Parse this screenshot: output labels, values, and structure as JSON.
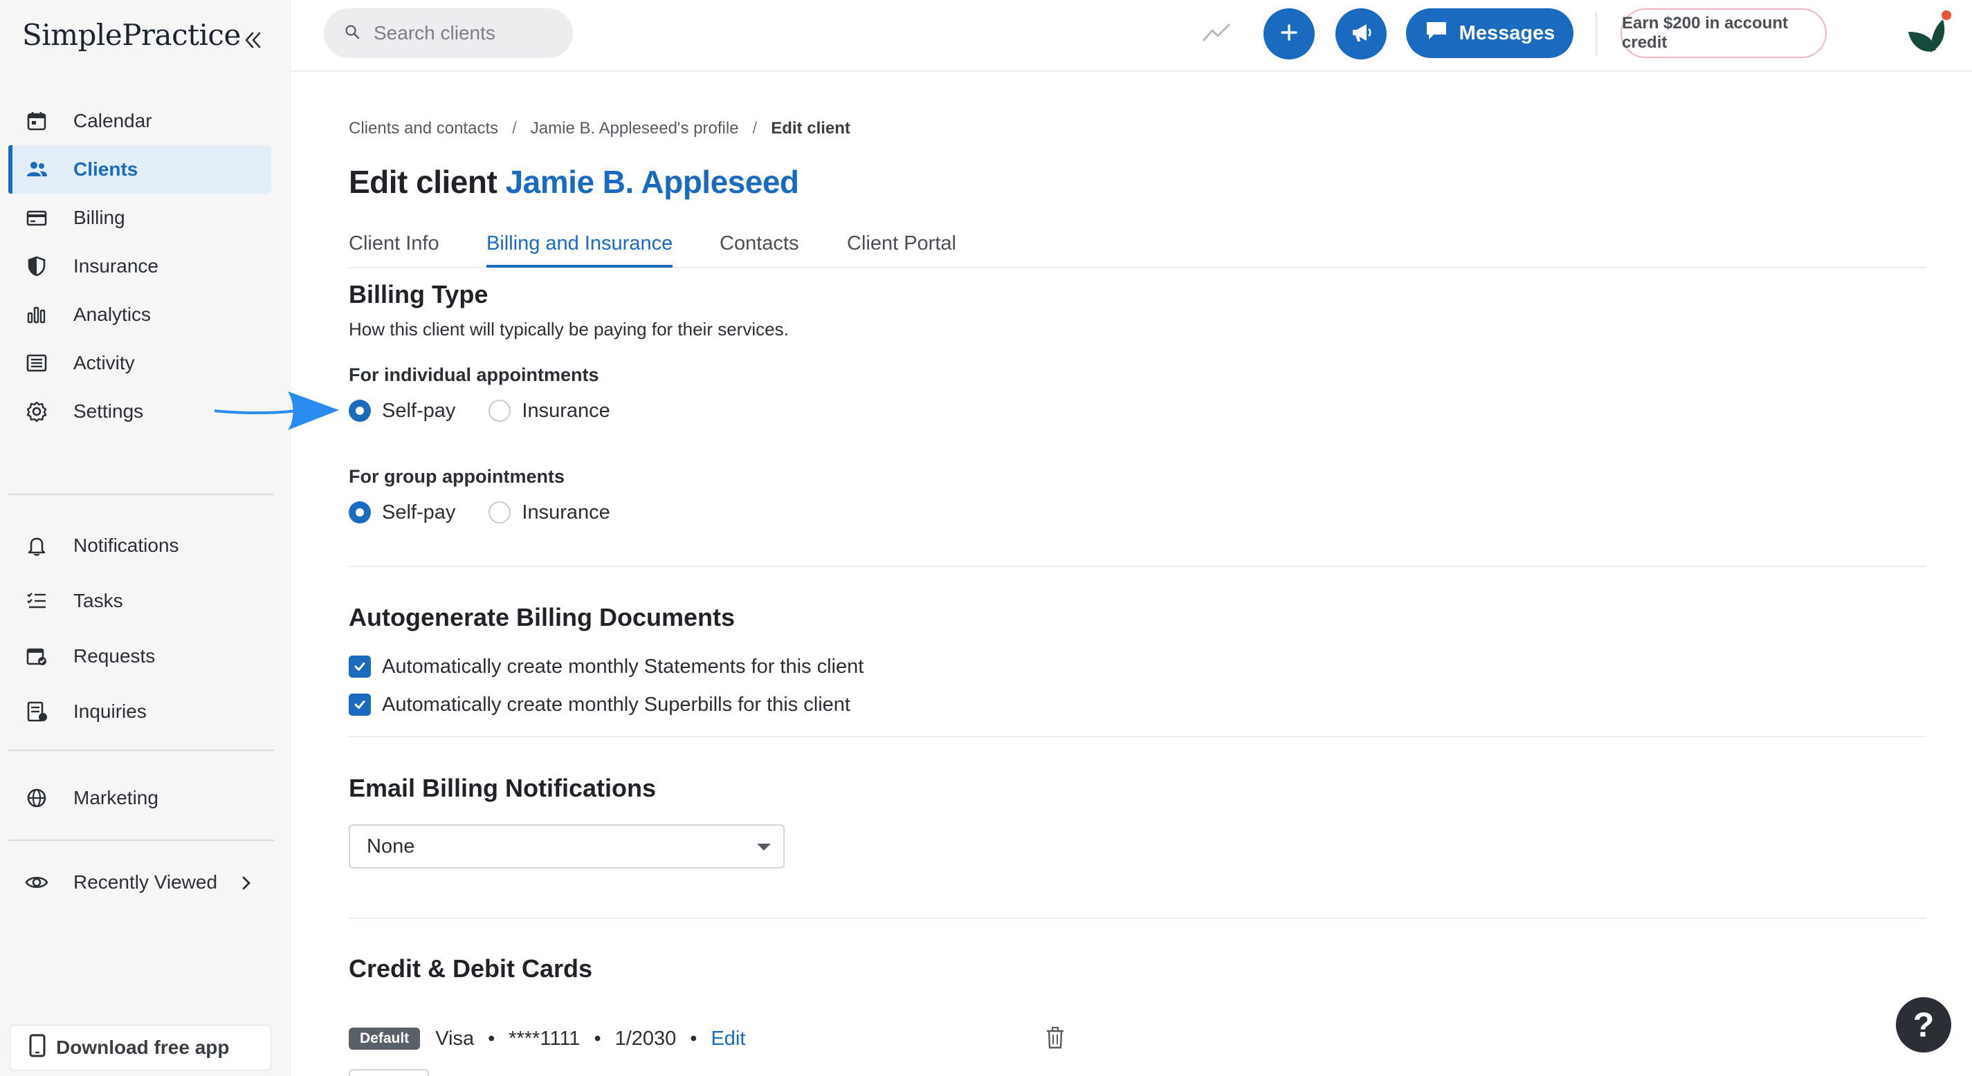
{
  "app": {
    "logo_text": "SimplePractice"
  },
  "sidebar": {
    "items": [
      {
        "label": "Calendar",
        "icon": "calendar-icon"
      },
      {
        "label": "Clients",
        "icon": "clients-icon",
        "active": true
      },
      {
        "label": "Billing",
        "icon": "billing-icon"
      },
      {
        "label": "Insurance",
        "icon": "shield-icon"
      },
      {
        "label": "Analytics",
        "icon": "bar-chart-icon"
      },
      {
        "label": "Activity",
        "icon": "activity-list-icon"
      },
      {
        "label": "Settings",
        "icon": "gear-icon"
      }
    ],
    "secondary": [
      {
        "label": "Notifications",
        "icon": "bell-icon"
      },
      {
        "label": "Tasks",
        "icon": "tasks-icon"
      },
      {
        "label": "Requests",
        "icon": "requests-icon"
      },
      {
        "label": "Inquiries",
        "icon": "inquiries-icon"
      }
    ],
    "marketing": {
      "label": "Marketing",
      "icon": "globe-icon"
    },
    "recently_viewed": {
      "label": "Recently Viewed",
      "icon": "eye-icon"
    },
    "download_app": "Download free app"
  },
  "topbar": {
    "search_placeholder": "Search clients",
    "messages_label": "Messages",
    "earn_label": "Earn $200 in account credit"
  },
  "breadcrumb": {
    "items": [
      "Clients and contacts",
      "Jamie B. Appleseed's profile",
      "Edit client"
    ],
    "separator": "/"
  },
  "page": {
    "title_prefix": "Edit client",
    "client_name": "Jamie B. Appleseed"
  },
  "tabs": [
    {
      "label": "Client Info"
    },
    {
      "label": "Billing and Insurance",
      "active": true
    },
    {
      "label": "Contacts"
    },
    {
      "label": "Client Portal"
    }
  ],
  "billing_type": {
    "title": "Billing Type",
    "description": "How this client will typically be paying for their services.",
    "individual": {
      "label": "For individual appointments",
      "options": [
        "Self-pay",
        "Insurance"
      ],
      "selected": "Self-pay"
    },
    "group": {
      "label": "For group appointments",
      "options": [
        "Self-pay",
        "Insurance"
      ],
      "selected": "Self-pay"
    }
  },
  "autogenerate": {
    "title": "Autogenerate Billing Documents",
    "statements_label": "Automatically create monthly Statements for this client",
    "statements_checked": true,
    "superbills_label": "Automatically create monthly Superbills for this client",
    "superbills_checked": true
  },
  "email_notifications": {
    "title": "Email Billing Notifications",
    "selected": "None"
  },
  "cards": {
    "title": "Credit & Debit Cards",
    "items": [
      {
        "badge": "Default",
        "brand": "Visa",
        "number": "****1111",
        "expiry": "1/2030",
        "edit_label": "Edit"
      }
    ]
  },
  "help_label": "?",
  "colors": {
    "accent": "#1a6ac0",
    "annotation_arrow": "#2a8cf0"
  }
}
